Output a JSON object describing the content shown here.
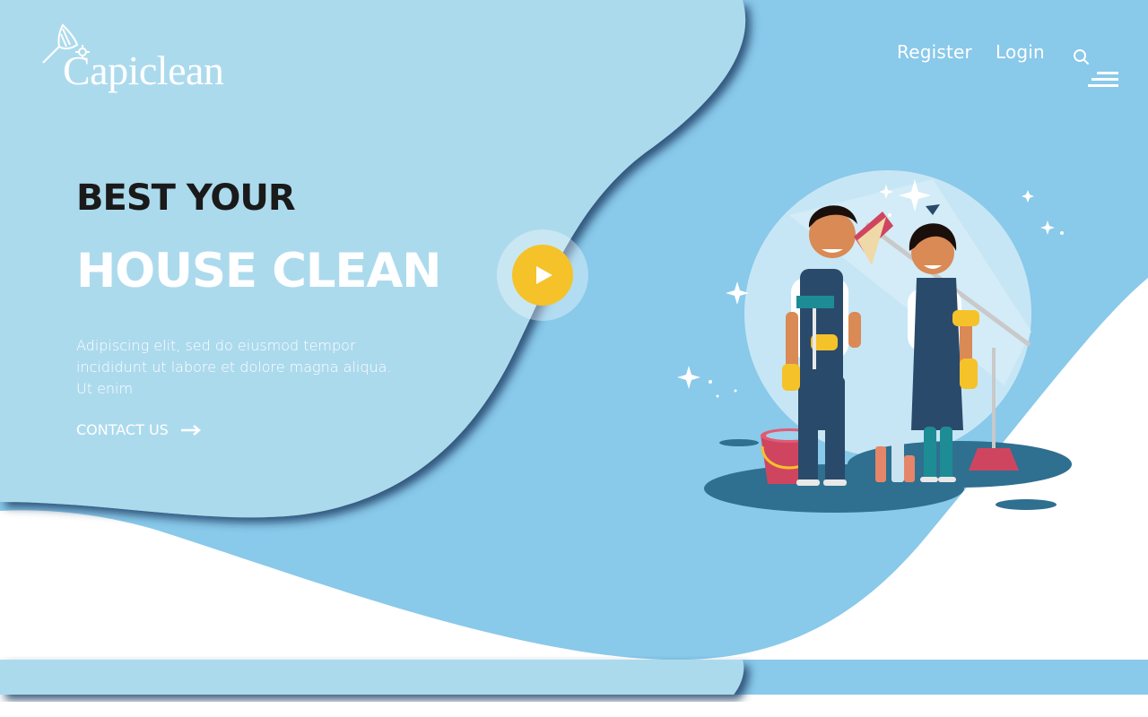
{
  "brand": {
    "name": "Capiclean"
  },
  "nav": {
    "register": "Register",
    "login": "Login",
    "search_icon": "search-icon",
    "menu_icon": "hamburger-menu-icon"
  },
  "hero": {
    "subtitle": "BEST YOUR",
    "title": "HOUSE CLEAN",
    "description": "Adipiscing elit, sed do eiusmod tempor incididunt ut labore et dolore magna aliqua. Ut enim",
    "cta": "CONTACT US"
  },
  "colors": {
    "light_blue": "#acdaed",
    "sky_blue": "#89c9ea",
    "accent_yellow": "#f5c22a",
    "dark_text": "#1a1a1a"
  }
}
